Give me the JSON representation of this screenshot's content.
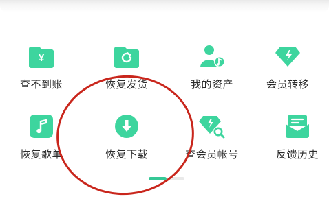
{
  "colors": {
    "accent": "#3dd59e",
    "annotation": "#c9261c",
    "text": "#2b2b2b"
  },
  "grid": {
    "items": [
      {
        "label": "查不到账",
        "icon": "yen-folder-icon"
      },
      {
        "label": "恢复发货",
        "icon": "refresh-folder-icon"
      },
      {
        "label": "我的资产",
        "icon": "user-music-icon"
      },
      {
        "label": "会员转移",
        "icon": "diamond-transfer-icon"
      },
      {
        "label": "恢复歌单",
        "icon": "music-note-icon"
      },
      {
        "label": "恢复下载",
        "icon": "download-circle-icon"
      },
      {
        "label": "查会员帐号",
        "icon": "diamond-search-icon"
      },
      {
        "label": "反馈历史",
        "icon": "envelope-icon"
      }
    ]
  },
  "pager": {
    "pages": 2,
    "current": 1
  }
}
